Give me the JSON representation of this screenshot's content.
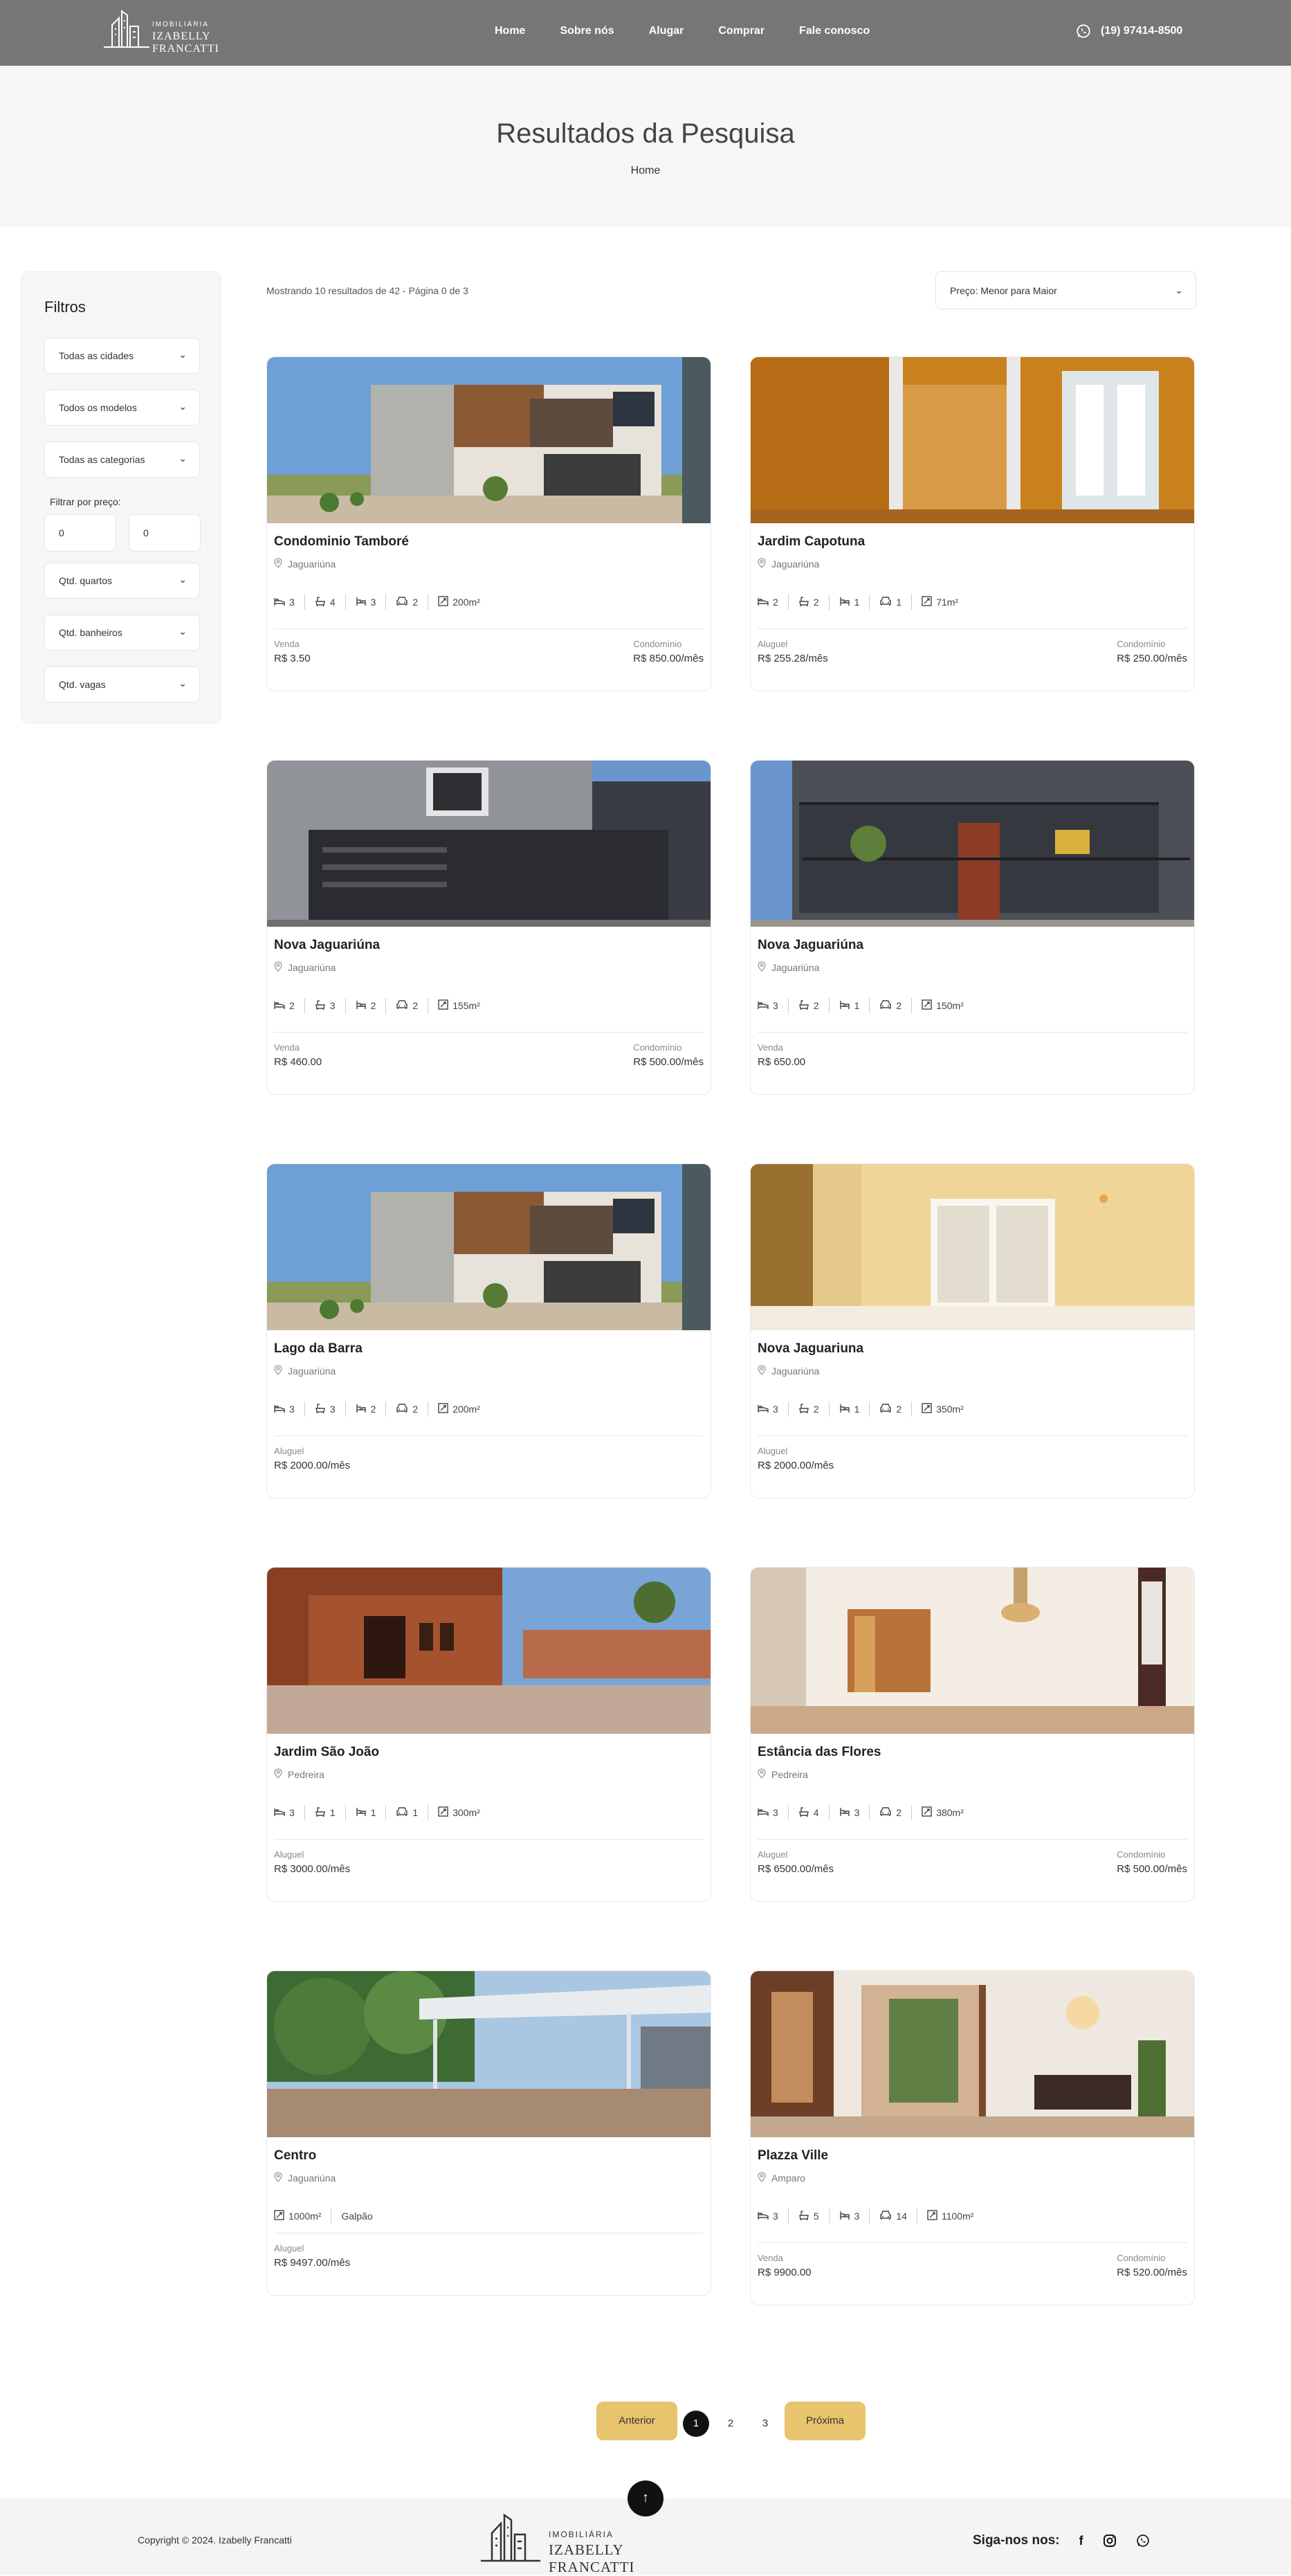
{
  "header": {
    "logo_top": "IMOBILIÁRIA",
    "logo_name": "IZABELLY FRANCATTI",
    "nav": [
      "Home",
      "Sobre nós",
      "Alugar",
      "Comprar",
      "Fale conosco"
    ],
    "phone": "(19) 97414-8500",
    "colors": {
      "background": "#777676",
      "accent": "#e8c46e"
    }
  },
  "hero": {
    "title": "Resultados da Pesquisa",
    "breadcrumb": "Home"
  },
  "filters": {
    "title": "Filtros",
    "city": "Todas as cidades",
    "model": "Todos os modelos",
    "category": "Todas as categorias",
    "price_label": "Filtrar por preço:",
    "price_min": "0",
    "price_max": "0",
    "bedrooms": "Qtd. quartos",
    "bathrooms": "Qtd. banheiros",
    "parking": "Qtd. vagas"
  },
  "results": {
    "count_text": "Mostrando 10 resultados de 42 - Página 0 de 3",
    "sort_value": "Preço: Menor para Maior"
  },
  "listings": [
    {
      "title": "Condominio Tamboré",
      "city": "Jaguariúna",
      "features": [
        {
          "icon": "bed-icon",
          "value": "3"
        },
        {
          "icon": "bath-icon",
          "value": "4"
        },
        {
          "icon": "suite-icon",
          "value": "3"
        },
        {
          "icon": "car-icon",
          "value": "2"
        },
        {
          "icon": "area-icon",
          "value": "200m²"
        }
      ],
      "price_label": "Venda",
      "price": "R$ 3.50",
      "condo_label": "Condomínio",
      "condo": "R$ 850.00/mês"
    },
    {
      "title": "Jardim Capotuna",
      "city": "Jaguariúna",
      "features": [
        {
          "icon": "bed-icon",
          "value": "2"
        },
        {
          "icon": "bath-icon",
          "value": "2"
        },
        {
          "icon": "suite-icon",
          "value": "1"
        },
        {
          "icon": "car-icon",
          "value": "1"
        },
        {
          "icon": "area-icon",
          "value": "71m²"
        }
      ],
      "price_label": "Aluguel",
      "price": "R$ 255.28/mês",
      "condo_label": "Condomínio",
      "condo": "R$ 250.00/mês"
    },
    {
      "title": "Nova Jaguariúna",
      "city": "Jaguariúna",
      "features": [
        {
          "icon": "bed-icon",
          "value": "2"
        },
        {
          "icon": "bath-icon",
          "value": "3"
        },
        {
          "icon": "suite-icon",
          "value": "2"
        },
        {
          "icon": "car-icon",
          "value": "2"
        },
        {
          "icon": "area-icon",
          "value": "155m²"
        }
      ],
      "price_label": "Venda",
      "price": "R$ 460.00",
      "condo_label": "Condomínio",
      "condo": "R$ 500.00/mês"
    },
    {
      "title": "Nova Jaguariúna",
      "city": "Jaguariúna",
      "features": [
        {
          "icon": "bed-icon",
          "value": "3"
        },
        {
          "icon": "bath-icon",
          "value": "2"
        },
        {
          "icon": "suite-icon",
          "value": "1"
        },
        {
          "icon": "car-icon",
          "value": "2"
        },
        {
          "icon": "area-icon",
          "value": "150m²"
        }
      ],
      "price_label": "Venda",
      "price": "R$ 650.00",
      "condo_label": "",
      "condo": ""
    },
    {
      "title": "Lago da Barra",
      "city": "Jaguariúna",
      "features": [
        {
          "icon": "bed-icon",
          "value": "3"
        },
        {
          "icon": "bath-icon",
          "value": "3"
        },
        {
          "icon": "suite-icon",
          "value": "2"
        },
        {
          "icon": "car-icon",
          "value": "2"
        },
        {
          "icon": "area-icon",
          "value": "200m²"
        }
      ],
      "price_label": "Aluguel",
      "price": "R$ 2000.00/mês",
      "condo_label": "",
      "condo": ""
    },
    {
      "title": "Nova Jaguariuna",
      "city": "Jaguariúna",
      "features": [
        {
          "icon": "bed-icon",
          "value": "3"
        },
        {
          "icon": "bath-icon",
          "value": "2"
        },
        {
          "icon": "suite-icon",
          "value": "1"
        },
        {
          "icon": "car-icon",
          "value": "2"
        },
        {
          "icon": "area-icon",
          "value": "350m²"
        }
      ],
      "price_label": "Aluguel",
      "price": "R$ 2000.00/mês",
      "condo_label": "",
      "condo": ""
    },
    {
      "title": "Jardim São João",
      "city": "Pedreira",
      "features": [
        {
          "icon": "bed-icon",
          "value": "3"
        },
        {
          "icon": "bath-icon",
          "value": "1"
        },
        {
          "icon": "suite-icon",
          "value": "1"
        },
        {
          "icon": "car-icon",
          "value": "1"
        },
        {
          "icon": "area-icon",
          "value": "300m²"
        }
      ],
      "price_label": "Aluguel",
      "price": "R$ 3000.00/mês",
      "condo_label": "",
      "condo": ""
    },
    {
      "title": "Estância das Flores",
      "city": "Pedreira",
      "features": [
        {
          "icon": "bed-icon",
          "value": "3"
        },
        {
          "icon": "bath-icon",
          "value": "4"
        },
        {
          "icon": "suite-icon",
          "value": "3"
        },
        {
          "icon": "car-icon",
          "value": "2"
        },
        {
          "icon": "area-icon",
          "value": "380m²"
        }
      ],
      "price_label": "Aluguel",
      "price": "R$ 6500.00/mês",
      "condo_label": "Condomínio",
      "condo": "R$ 500.00/mês"
    },
    {
      "title": "Centro",
      "city": "Jaguariúna",
      "features": [
        {
          "icon": "area-icon",
          "value": "1000m²"
        },
        {
          "icon": "",
          "value": "Galpão"
        }
      ],
      "price_label": "Aluguel",
      "price": "R$ 9497.00/mês",
      "condo_label": "",
      "condo": ""
    },
    {
      "title": "Plazza Ville",
      "city": "Amparo",
      "features": [
        {
          "icon": "bed-icon",
          "value": "3"
        },
        {
          "icon": "bath-icon",
          "value": "5"
        },
        {
          "icon": "suite-icon",
          "value": "3"
        },
        {
          "icon": "car-icon",
          "value": "14"
        },
        {
          "icon": "area-icon",
          "value": "1100m²"
        }
      ],
      "price_label": "Venda",
      "price": "R$ 9900.00",
      "condo_label": "Condomínio",
      "condo": "R$ 520.00/mês"
    }
  ],
  "pagination": {
    "prev": "Anterior",
    "next": "Próxima",
    "pages": [
      "1",
      "2",
      "3"
    ],
    "current": "1"
  },
  "footer": {
    "copyright": "Copyright © 2024. Izabelly Francatti",
    "logo_top": "IMOBILIÁRIA",
    "logo_name": "IZABELLY FRANCATTI",
    "social_label": "Siga-nos nos:",
    "social_icons": [
      "facebook-icon",
      "instagram-icon",
      "whatsapp-icon"
    ]
  }
}
